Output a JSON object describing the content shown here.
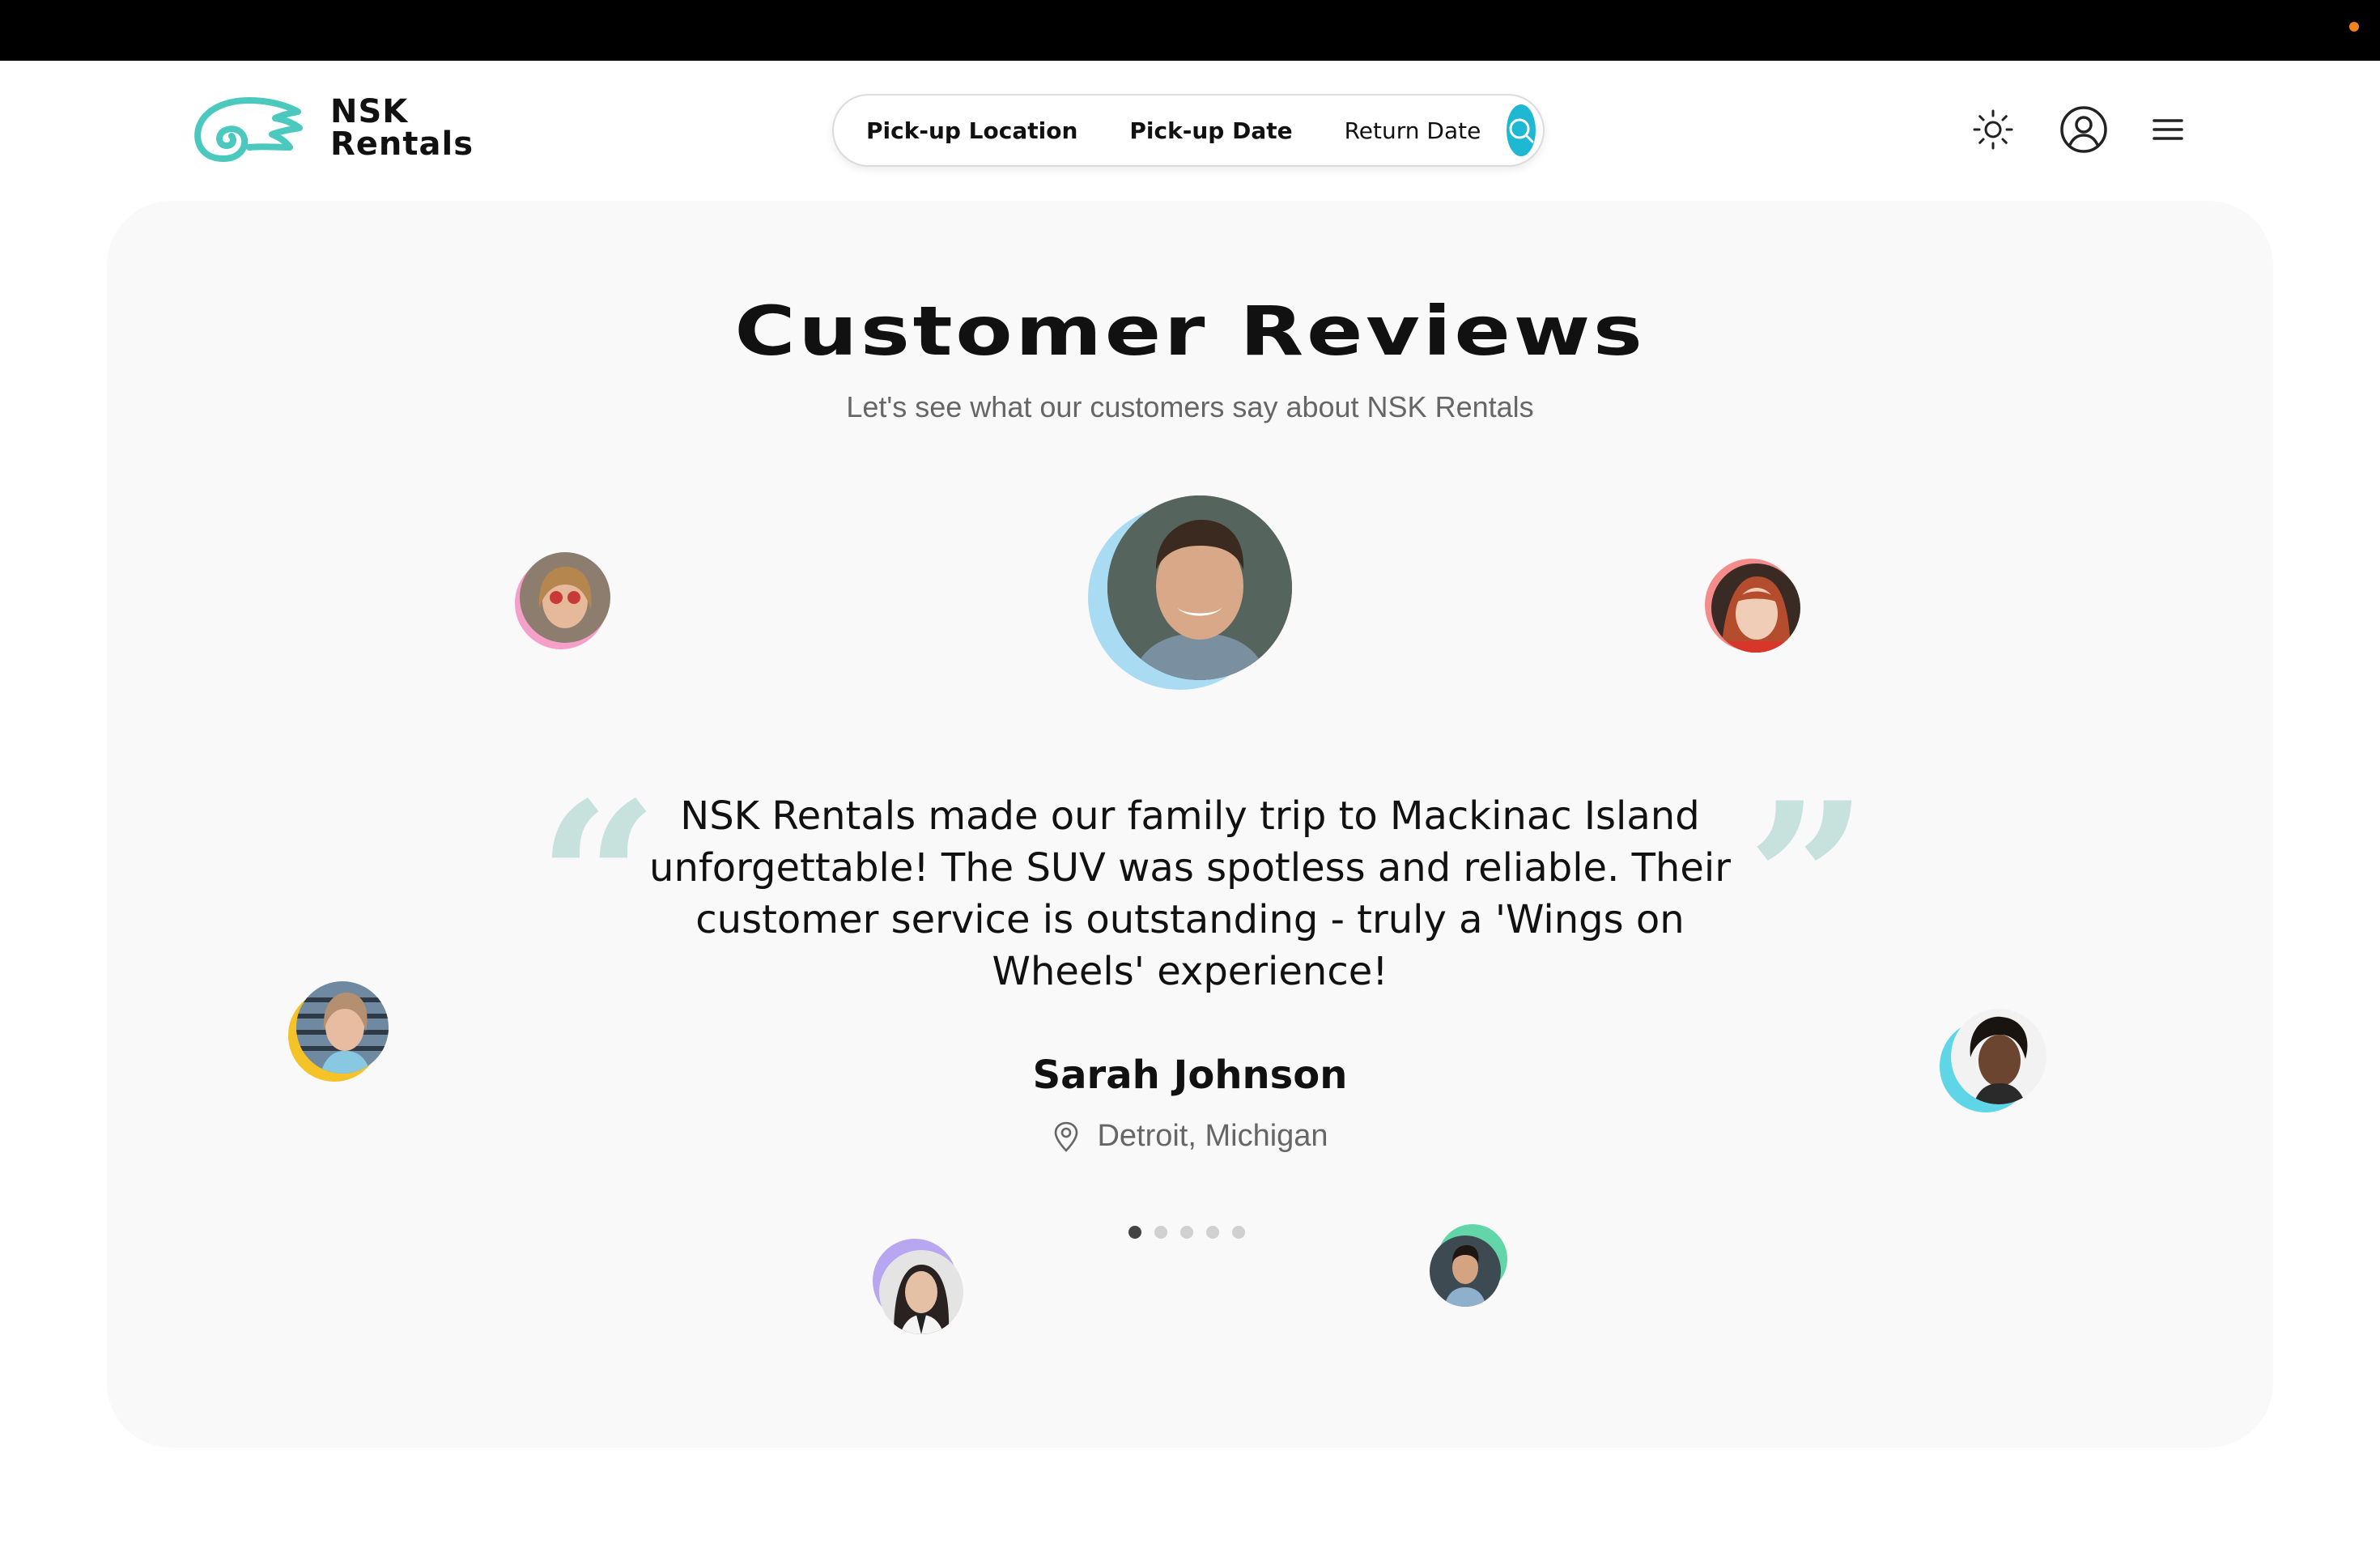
{
  "colors": {
    "accent": "#1fb8d2",
    "logo_teal": "#4cc9bf",
    "quote_mark": "#c7e1dc",
    "window_dot": "#f5821f"
  },
  "brand": {
    "line1": "NSK",
    "line2": "Rentals",
    "icon": "wing-icon"
  },
  "search": {
    "pickup_location": "Pick-up Location",
    "pickup_date": "Pick-up Date",
    "return_date": "Return Date",
    "icon": "search-icon"
  },
  "header_icons": [
    "sun-icon",
    "user-circle-icon",
    "menu-icon"
  ],
  "reviews": {
    "title": "Customer Reviews",
    "subtitle": "Let's see what our customers say about NSK Rentals",
    "active_review": {
      "text": "NSK Rentals made our family trip to Mackinac Island unforgettable! The SUV was spotless and reliable. Their customer service is outstanding - truly a 'Wings on Wheels' experience!",
      "name": "Sarah Johnson",
      "location": "Detroit, Michigan"
    },
    "pagination": {
      "total": 5,
      "active_index": 0
    },
    "avatars": [
      {
        "ring": "#a9dcf3"
      },
      {
        "ring": "#f5a0c8"
      },
      {
        "ring": "#f58c8c"
      },
      {
        "ring": "#f5c227"
      },
      {
        "ring": "#5fd6e8"
      },
      {
        "ring": "#b9a6f0"
      },
      {
        "ring": "#62d6a8"
      }
    ]
  }
}
